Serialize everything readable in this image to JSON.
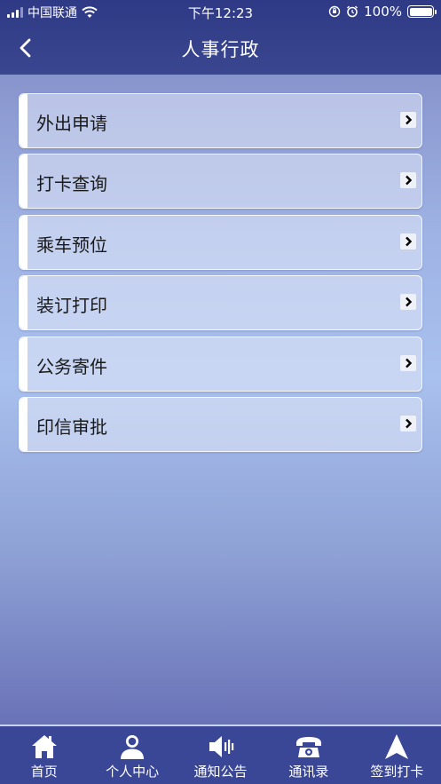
{
  "status_bar": {
    "carrier": "中国联通",
    "time": "下午12:23",
    "battery": "100%"
  },
  "header": {
    "title": "人事行政",
    "back_icon": "chevron-left-icon"
  },
  "menu": {
    "items": [
      {
        "label": "外出申请",
        "icon": "chevron-right-icon"
      },
      {
        "label": "打卡查询",
        "icon": "chevron-right-icon"
      },
      {
        "label": "乘车预位",
        "icon": "chevron-right-icon"
      },
      {
        "label": "装订打印",
        "icon": "chevron-right-icon"
      },
      {
        "label": "公务寄件",
        "icon": "chevron-right-icon"
      },
      {
        "label": "印信审批",
        "icon": "chevron-right-icon"
      }
    ]
  },
  "tab_bar": {
    "tabs": [
      {
        "label": "首页",
        "icon": "home-icon"
      },
      {
        "label": "个人中心",
        "icon": "user-icon"
      },
      {
        "label": "通知公告",
        "icon": "speaker-icon"
      },
      {
        "label": "通讯录",
        "icon": "telephone-icon"
      },
      {
        "label": "签到打卡",
        "icon": "navigation-arrow-icon"
      }
    ]
  },
  "colors": {
    "header_bg": "#2f3a86",
    "tab_bar_bg": "#3a4796",
    "accent": "#ffffff"
  }
}
